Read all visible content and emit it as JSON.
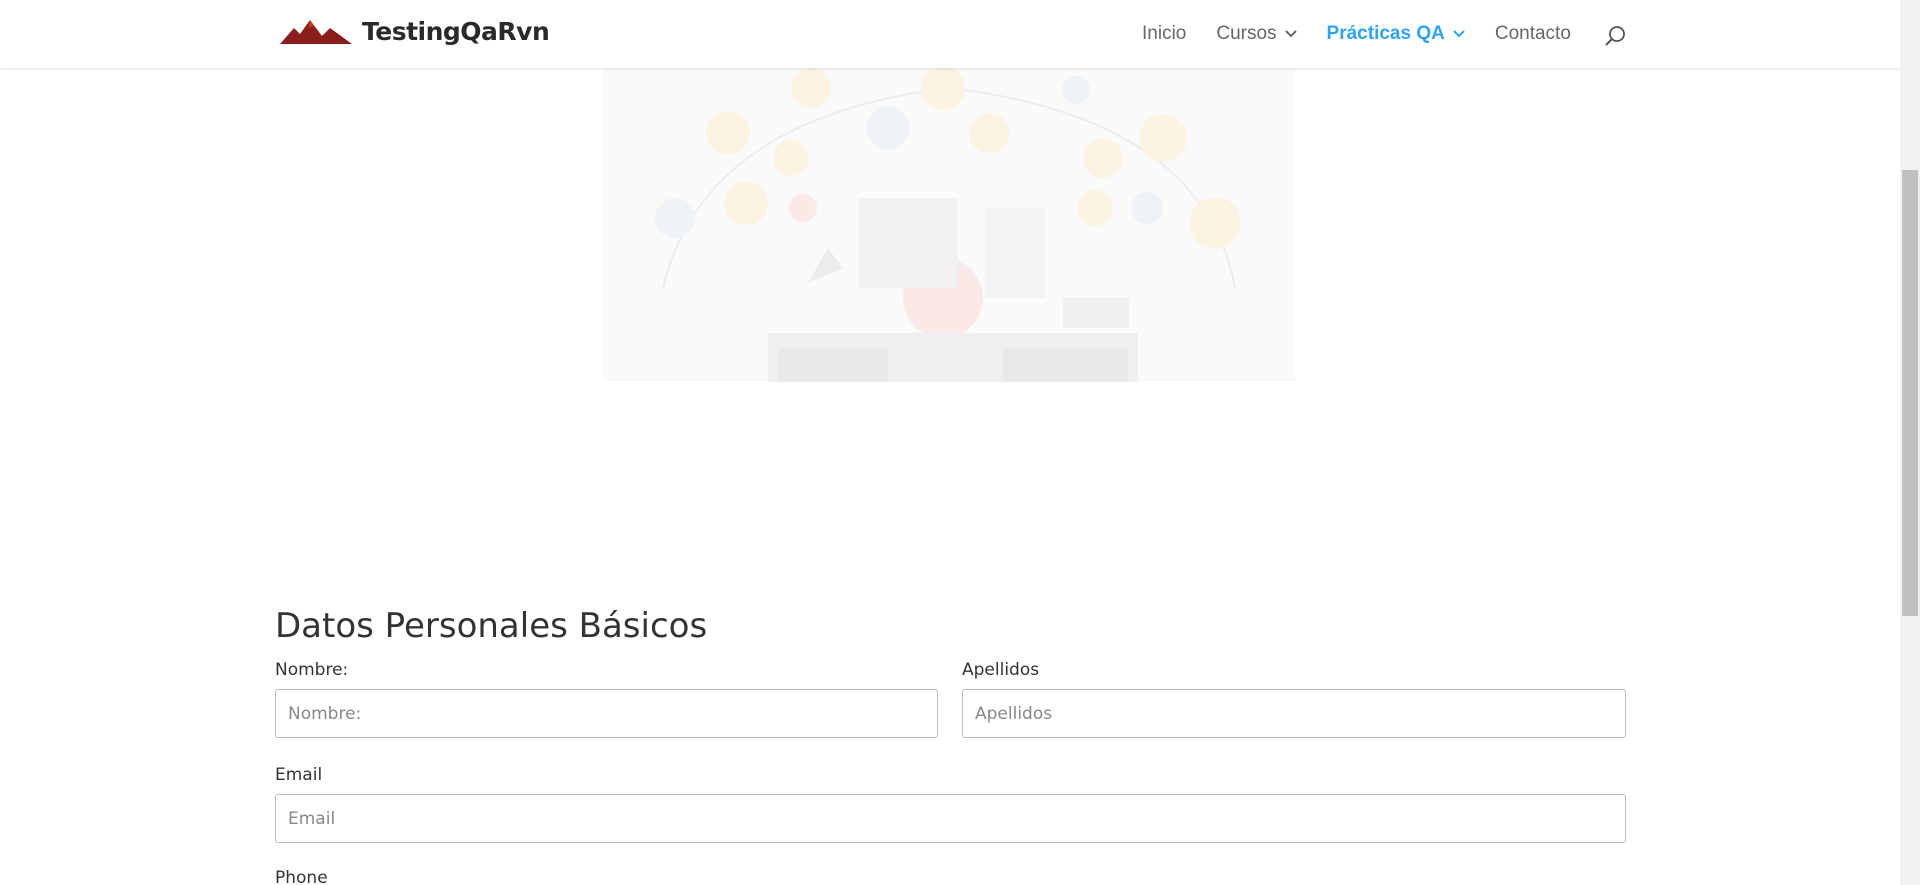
{
  "header": {
    "logo_text": "TestingQaRvn",
    "nav": {
      "inicio": "Inicio",
      "cursos": "Cursos",
      "practicas": "Prácticas QA",
      "contacto": "Contacto"
    }
  },
  "hero": {
    "image": "qa-testing-illustration"
  },
  "form": {
    "title": "Datos Personales Básicos",
    "nombre": {
      "label": "Nombre:",
      "placeholder": "Nombre:"
    },
    "apellidos": {
      "label": "Apellidos",
      "placeholder": "Apellidos"
    },
    "email": {
      "label": "Email",
      "placeholder": "Email"
    },
    "phone": {
      "label": "Phone"
    }
  },
  "colors": {
    "accent": "#2ea3f2",
    "logo_mountain": "#8b1d1d"
  }
}
